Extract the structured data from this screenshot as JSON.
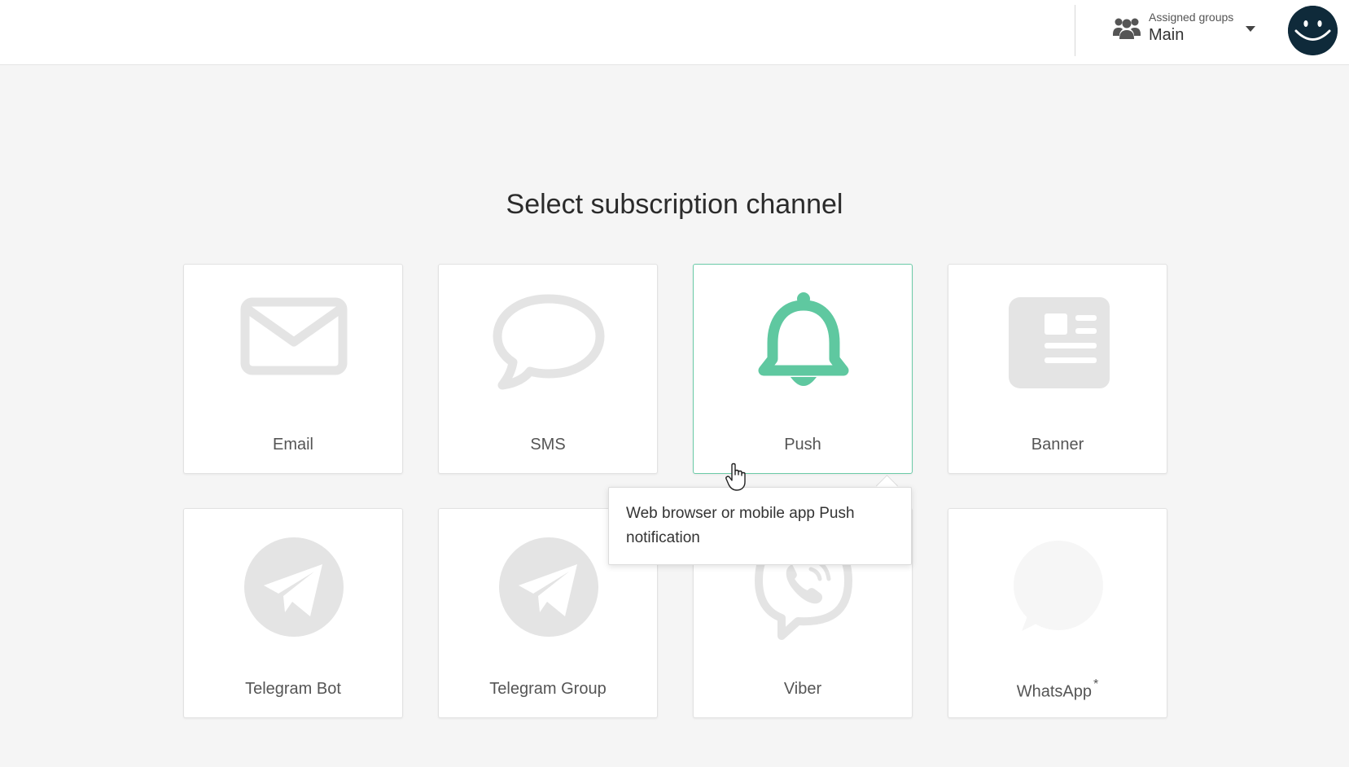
{
  "header": {
    "assigned_groups_label": "Assigned groups",
    "assigned_groups_value": "Main"
  },
  "main": {
    "title": "Select subscription channel",
    "channels": [
      {
        "label": "Email",
        "icon": "envelope-icon",
        "state": "default"
      },
      {
        "label": "SMS",
        "icon": "speech-bubble-icon",
        "state": "default"
      },
      {
        "label": "Push",
        "icon": "bell-icon",
        "state": "hover"
      },
      {
        "label": "Banner",
        "icon": "newspaper-icon",
        "state": "default"
      },
      {
        "label": "Telegram Bot",
        "icon": "telegram-icon",
        "state": "default"
      },
      {
        "label": "Telegram Group",
        "icon": "telegram-icon",
        "state": "default"
      },
      {
        "label": "Viber",
        "icon": "viber-icon",
        "state": "default"
      },
      {
        "label": "WhatsApp",
        "icon": "whatsapp-icon",
        "state": "disabled",
        "marker": "*"
      }
    ],
    "tooltip": "Web browser or mobile app Push notification"
  },
  "colors": {
    "accent": "#5fc8a0",
    "icon_inactive": "#e4e4e4",
    "background": "#f5f5f5",
    "avatar": "#0f2a3a"
  }
}
